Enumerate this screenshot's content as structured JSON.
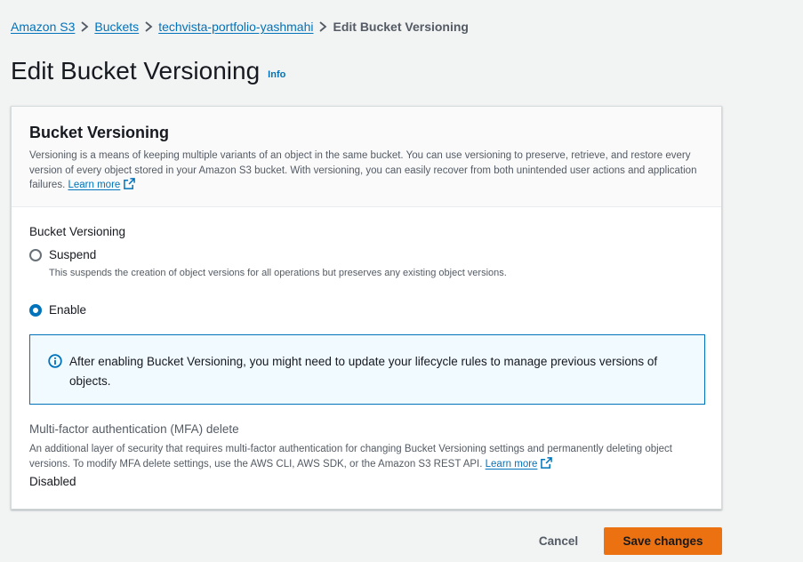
{
  "breadcrumb": {
    "items": [
      "Amazon S3",
      "Buckets",
      "techvista-portfolio-yashmahi"
    ],
    "current": "Edit Bucket Versioning"
  },
  "page": {
    "title": "Edit Bucket Versioning",
    "info_label": "Info"
  },
  "panel": {
    "title": "Bucket Versioning",
    "description": "Versioning is a means of keeping multiple variants of an object in the same bucket. You can use versioning to preserve, retrieve, and restore every version of every object stored in your Amazon S3 bucket. With versioning, you can easily recover from both unintended user actions and application failures.",
    "learn_more": "Learn more"
  },
  "versioning": {
    "label": "Bucket Versioning",
    "options": [
      {
        "label": "Suspend",
        "description": "This suspends the creation of object versions for all operations but preserves any existing object versions.",
        "selected": false
      },
      {
        "label": "Enable",
        "description": "",
        "selected": true
      }
    ]
  },
  "alert": {
    "icon": "info-circle-icon",
    "text": "After enabling Bucket Versioning, you might need to update your lifecycle rules to manage previous versions of objects."
  },
  "mfa": {
    "label": "Multi-factor authentication (MFA) delete",
    "description": "An additional layer of security that requires multi-factor authentication for changing Bucket Versioning settings and permanently deleting object versions. To modify MFA delete settings, use the AWS CLI, AWS SDK, or the Amazon S3 REST API.",
    "learn_more": "Learn more",
    "value": "Disabled"
  },
  "actions": {
    "cancel": "Cancel",
    "save": "Save changes"
  },
  "colors": {
    "link": "#0073bb",
    "primary_button": "#ec7211",
    "background": "#f2f3f3",
    "alert_bg": "#f1faff"
  }
}
